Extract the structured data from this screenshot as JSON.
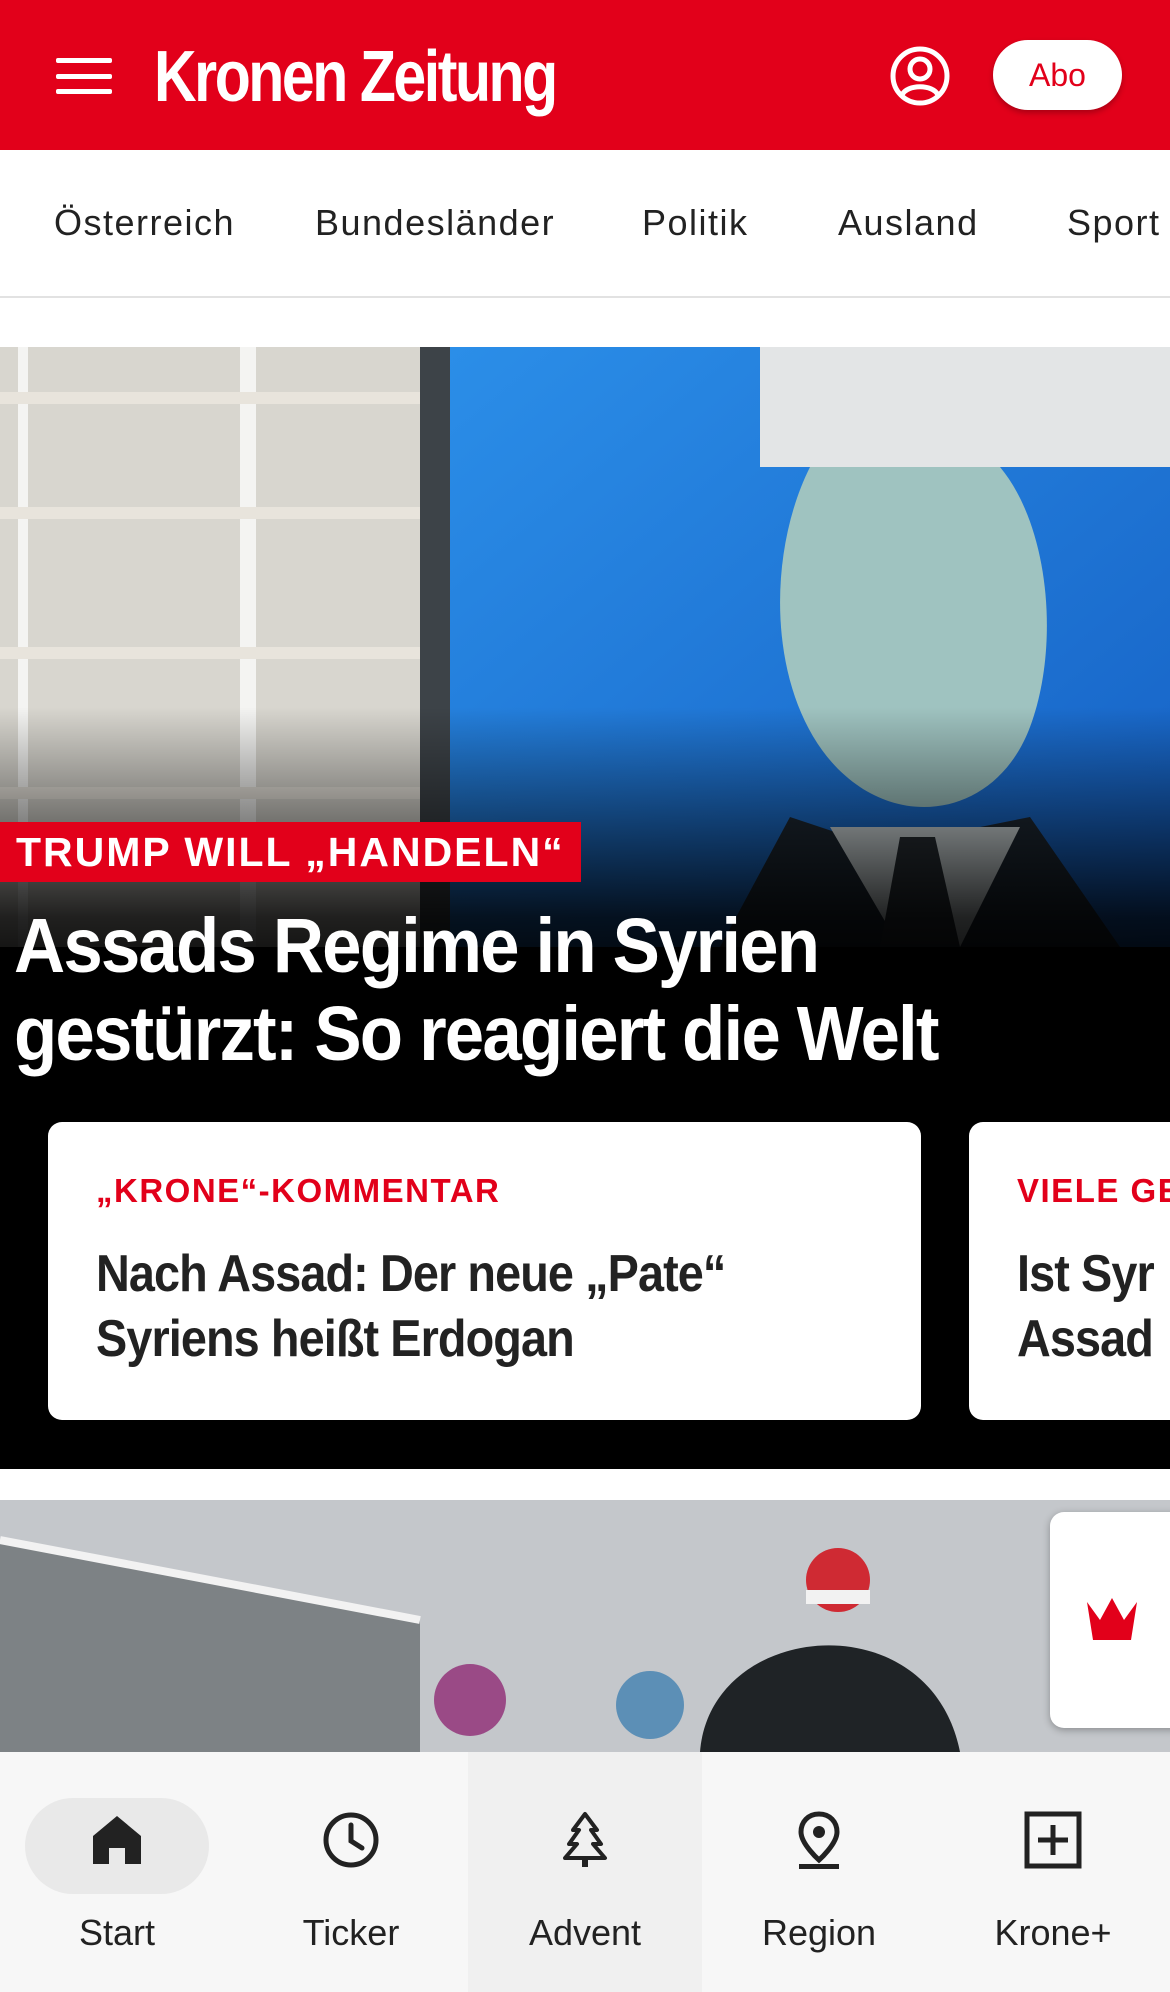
{
  "header": {
    "logo_text": "Kronen Zeitung",
    "abo_label": "Abo",
    "brand_color": "#e2001a"
  },
  "category_nav": {
    "items": [
      "Österreich",
      "Bundesländer",
      "Politik",
      "Ausland",
      "Sport"
    ]
  },
  "hero": {
    "kicker": "TRUMP WILL „HANDELN“",
    "title_line1": "Assads Regime in Syrien",
    "title_line2": "gestürzt: So reagiert die Welt",
    "cards": [
      {
        "kicker": "„KRONE“-KOMMENTAR",
        "title_line1": "Nach Assad: Der neue „Pate“",
        "title_line2": "Syriens heißt Erdogan"
      },
      {
        "kicker": "VIELE GE",
        "title_line1": "Ist Syr",
        "title_line2": "Assad"
      }
    ]
  },
  "bottom_nav": {
    "tabs": [
      {
        "label": "Start",
        "icon": "home-icon",
        "active": true
      },
      {
        "label": "Ticker",
        "icon": "clock-icon",
        "active": false
      },
      {
        "label": "Advent",
        "icon": "tree-icon",
        "active": false
      },
      {
        "label": "Region",
        "icon": "location-pin-icon",
        "active": false
      },
      {
        "label": "Krone+",
        "icon": "plus-box-icon",
        "active": false
      }
    ]
  }
}
